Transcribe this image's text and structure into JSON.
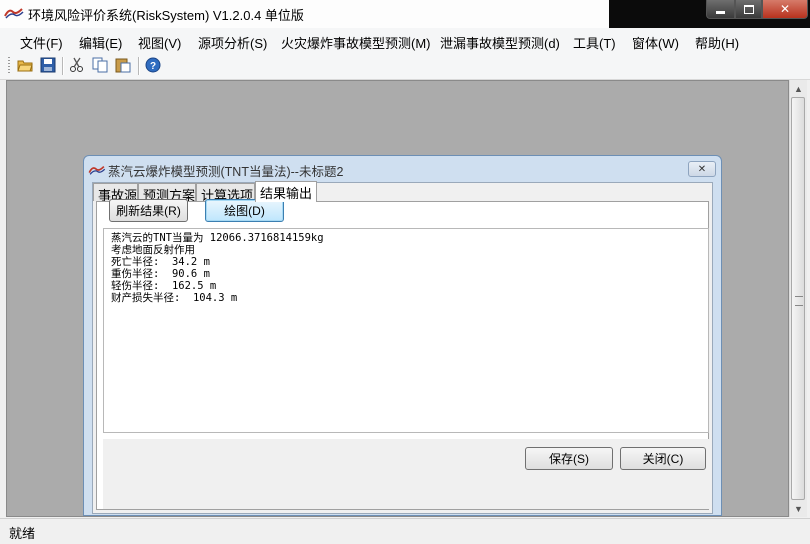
{
  "window": {
    "title": "环境风险评价系统(RiskSystem) V1.2.0.4 单位版",
    "icon": "risk-system-logo"
  },
  "menu": [
    {
      "label": "文件(F)"
    },
    {
      "label": "编辑(E)"
    },
    {
      "label": "视图(V)"
    },
    {
      "label": "源项分析(S)"
    },
    {
      "label": "火灾爆炸事故模型预测(M)"
    },
    {
      "label": "泄漏事故模型预测(d)"
    },
    {
      "label": "工具(T)"
    },
    {
      "label": "窗体(W)"
    },
    {
      "label": "帮助(H)"
    }
  ],
  "toolbar": {
    "icons": [
      "open-folder-icon",
      "save-disk-icon",
      "cut-icon",
      "copy-icon",
      "paste-icon",
      "help-icon"
    ]
  },
  "child_window": {
    "title": "蒸汽云爆炸模型预测(TNT当量法)--未标题2",
    "tabs": [
      {
        "label": "事故源"
      },
      {
        "label": "预测方案"
      },
      {
        "label": "计算选项"
      },
      {
        "label": "结果输出",
        "active": true
      }
    ],
    "refresh_button": "刷新结果(R)",
    "plot_button": "绘图(D)",
    "result_lines": [
      "蒸汽云的TNT当量为 12066.3716814159kg",
      "考虑地面反射作用",
      "死亡半径:  34.2 m",
      "重伤半径:  90.6 m",
      "轻伤半径:  162.5 m",
      "财产损失半径:  104.3 m"
    ],
    "save_button": "保存(S)",
    "close_button": "关闭(C)"
  },
  "status": {
    "text": "就绪"
  },
  "colors": {
    "mdi_background": "#ababab",
    "child_frame": "#cfdff0",
    "close_button_red": "#c23a22"
  }
}
